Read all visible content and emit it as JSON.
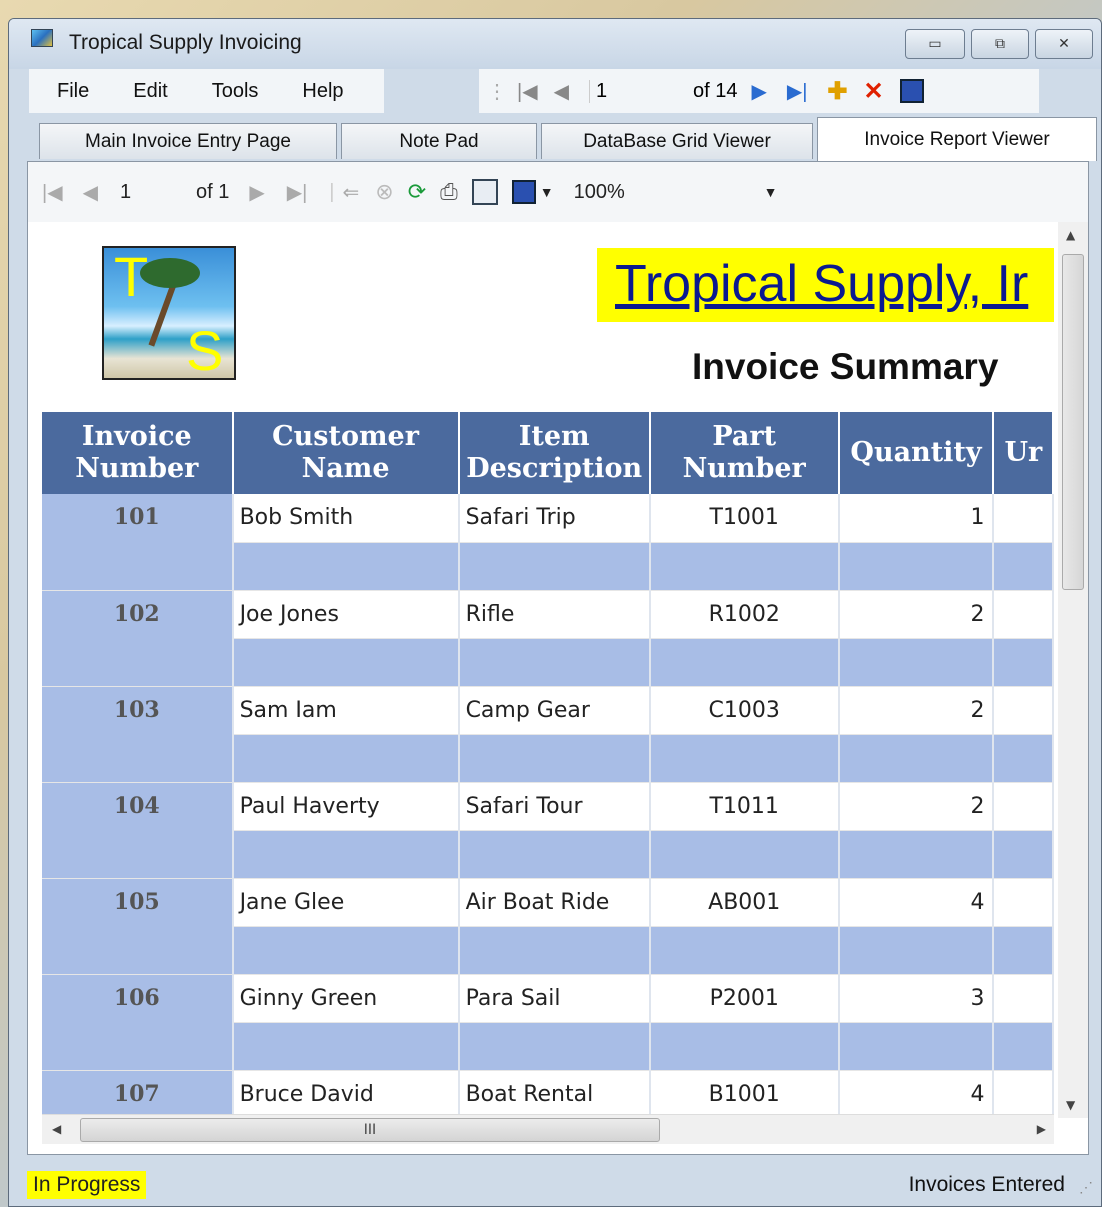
{
  "window": {
    "title": "Tropical Supply Invoicing",
    "buttons": {
      "minimize": "▭",
      "maximize": "⧉",
      "close": "✕"
    }
  },
  "menu": [
    "File",
    "Edit",
    "Tools",
    "Help"
  ],
  "navigator": {
    "position": "1",
    "of_text": "of 14"
  },
  "tabs": [
    "Main Invoice Entry Page",
    "Note Pad",
    "DataBase Grid Viewer",
    "Invoice Report Viewer"
  ],
  "active_tab": "Invoice Report Viewer",
  "report_toolbar": {
    "page": "1",
    "of_text": "of 1",
    "zoom": "100%"
  },
  "report": {
    "company_name": "Tropical Supply, Ir",
    "subtitle": "Invoice Summary",
    "logo_letters": {
      "top": "T",
      "bottom": "S"
    },
    "columns": [
      "Invoice Number",
      "Customer Name",
      "Item Description",
      "Part Number",
      "Quantity",
      "Ur"
    ],
    "rows": [
      {
        "invoice": "101",
        "customer": "Bob Smith",
        "item": "Safari Trip",
        "part": "T1001",
        "qty": "1"
      },
      {
        "invoice": "102",
        "customer": "Joe Jones",
        "item": "Rifle",
        "part": "R1002",
        "qty": "2"
      },
      {
        "invoice": "103",
        "customer": "Sam Iam",
        "item": "Camp Gear",
        "part": "C1003",
        "qty": "2"
      },
      {
        "invoice": "104",
        "customer": "Paul Haverty",
        "item": "Safari Tour",
        "part": "T1011",
        "qty": "2"
      },
      {
        "invoice": "105",
        "customer": "Jane Glee",
        "item": "Air Boat Ride",
        "part": "AB001",
        "qty": "4"
      },
      {
        "invoice": "106",
        "customer": "Ginny Green",
        "item": "Para Sail",
        "part": "P2001",
        "qty": "3"
      },
      {
        "invoice": "107",
        "customer": "Bruce David",
        "item": "Boat Rental",
        "part": "B1001",
        "qty": "4"
      }
    ]
  },
  "hscroll_grip": "III",
  "status": {
    "left": "In Progress",
    "right": "Invoices Entered"
  },
  "colors": {
    "header_blue": "#4b6a9e",
    "row_blue": "#a8bde6",
    "company_bg": "#ffff00",
    "status_highlight": "#ffff00"
  }
}
